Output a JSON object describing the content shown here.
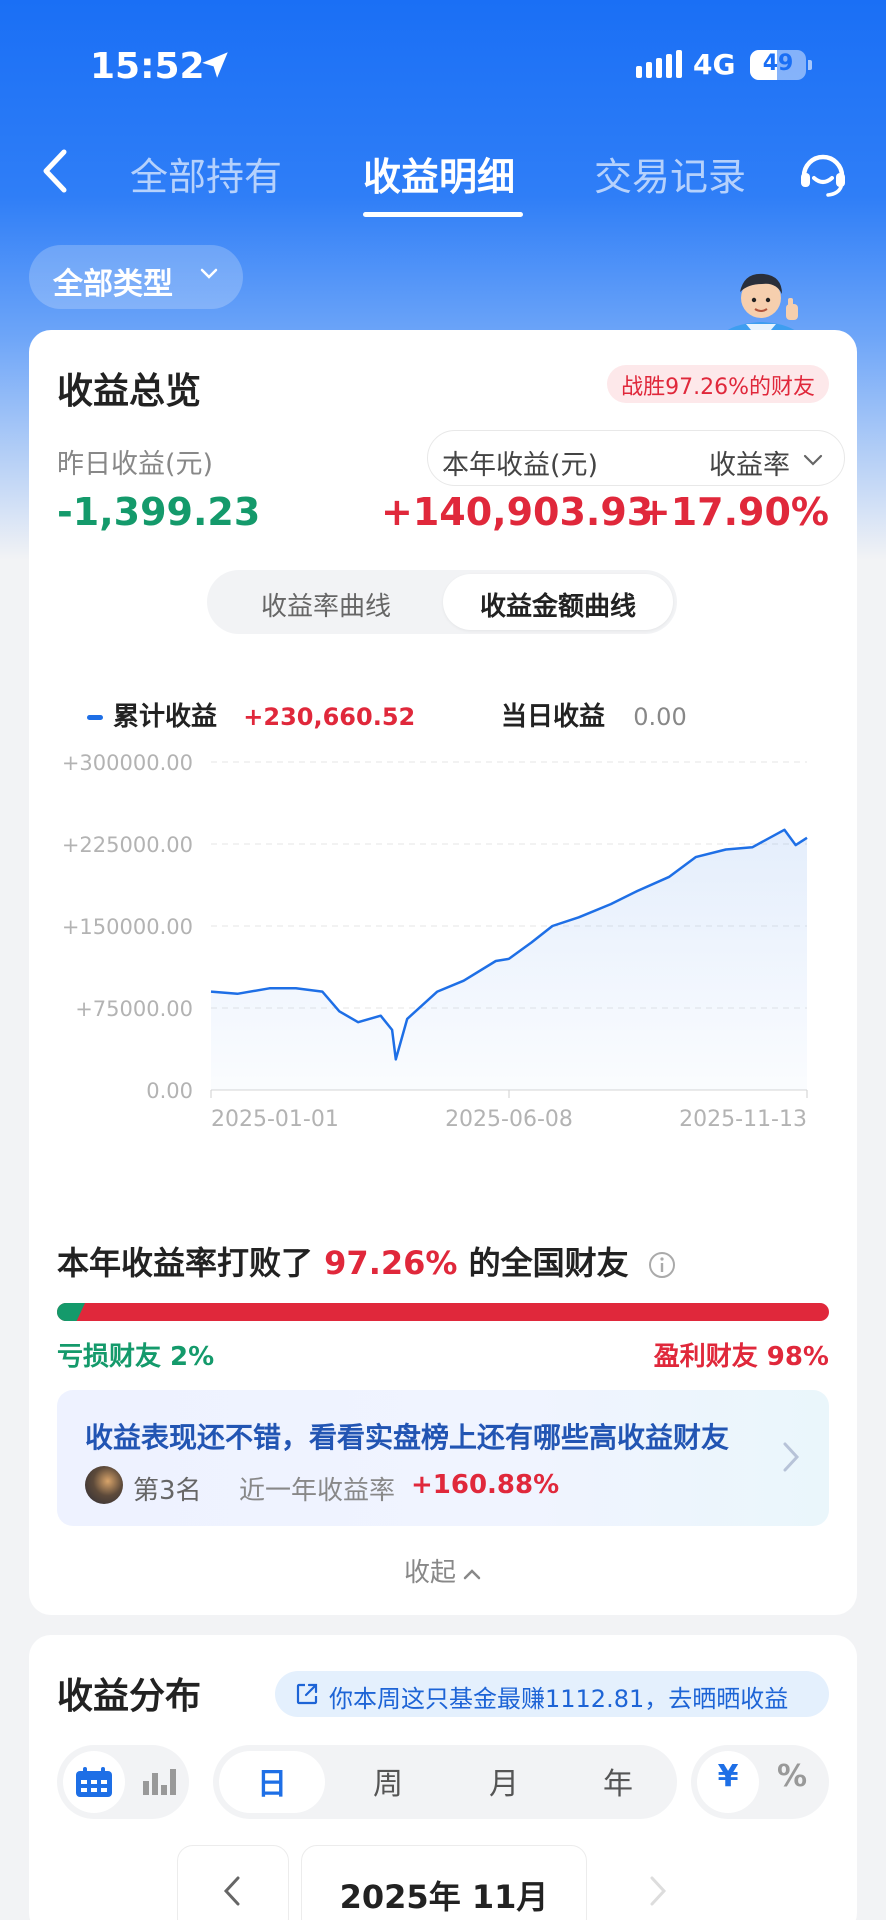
{
  "status": {
    "time": "15:52",
    "network": "4G",
    "battery": "49"
  },
  "nav": {
    "tabs": [
      {
        "label": "全部持有"
      },
      {
        "label": "收益明细"
      },
      {
        "label": "交易记录"
      }
    ],
    "active_tab": 1
  },
  "filter": {
    "type_label": "全部类型"
  },
  "overview": {
    "title": "收益总览",
    "win_badge": "战胜97.26%的财友",
    "yesterday_label": "昨日收益(元)",
    "yesterday_value": "-1,399.23",
    "year_label": "本年收益(元)",
    "rate_label": "收益率",
    "year_value": "+140,903.93",
    "rate_value": "+17.90%",
    "curve_tabs": [
      "收益率曲线",
      "收益金额曲线"
    ],
    "active_curve": 1,
    "legend": {
      "cum_label": "累计收益",
      "cum_value": "+230,660.52",
      "day_label": "当日收益",
      "day_value": "0.00"
    }
  },
  "chart_data": {
    "type": "area",
    "series": [
      {
        "name": "累计收益",
        "color": "#1e6fe6"
      }
    ],
    "x": [
      "2025-01-01",
      "2025-01-15",
      "2025-02-01",
      "2025-02-15",
      "2025-03-01",
      "2025-03-10",
      "2025-03-20",
      "2025-04-01",
      "2025-04-07",
      "2025-04-09",
      "2025-04-15",
      "2025-05-01",
      "2025-05-15",
      "2025-06-01",
      "2025-06-08",
      "2025-06-20",
      "2025-07-01",
      "2025-07-15",
      "2025-08-01",
      "2025-08-15",
      "2025-09-01",
      "2025-09-15",
      "2025-10-01",
      "2025-10-15",
      "2025-11-01",
      "2025-11-07",
      "2025-11-13"
    ],
    "values": [
      90000,
      88000,
      93000,
      93000,
      90000,
      72000,
      62000,
      68000,
      55000,
      28000,
      65000,
      90000,
      100000,
      118000,
      120000,
      135000,
      150000,
      158000,
      170000,
      182000,
      195000,
      213000,
      220000,
      222000,
      238000,
      224000,
      230660.52
    ],
    "y_ticks": [
      "+300000.00",
      "+225000.00",
      "+150000.00",
      "+75000.00",
      "0.00"
    ],
    "x_ticks": [
      "2025-01-01",
      "2025-06-08",
      "2025-11-13"
    ],
    "ylim": [
      0,
      300000
    ],
    "grid": true
  },
  "beat": {
    "prefix": "本年收益率打败了",
    "pct": "97.26%",
    "suffix": "的全国财友",
    "loss_label": "亏损财友 2%",
    "profit_label": "盈利财友 98%",
    "loss_fraction": 0.02
  },
  "promo": {
    "title": "收益表现还不错，看看实盘榜上还有哪些高收益财友",
    "rank": "第3名",
    "rate_label": "近一年收益率",
    "rate_value": "+160.88%"
  },
  "collapse_label": "收起",
  "distribution": {
    "title": "收益分布",
    "share_text": "你本周这只基金最赚1112.81，去晒晒收益",
    "periods": [
      "日",
      "周",
      "月",
      "年"
    ],
    "active_period": 0,
    "units": [
      "¥",
      "%"
    ],
    "active_unit": 0,
    "month_label": "2025年 11月"
  },
  "colors": {
    "primary": "#1e6fe6",
    "gain": "#e0283b",
    "loss": "#149a6b"
  }
}
